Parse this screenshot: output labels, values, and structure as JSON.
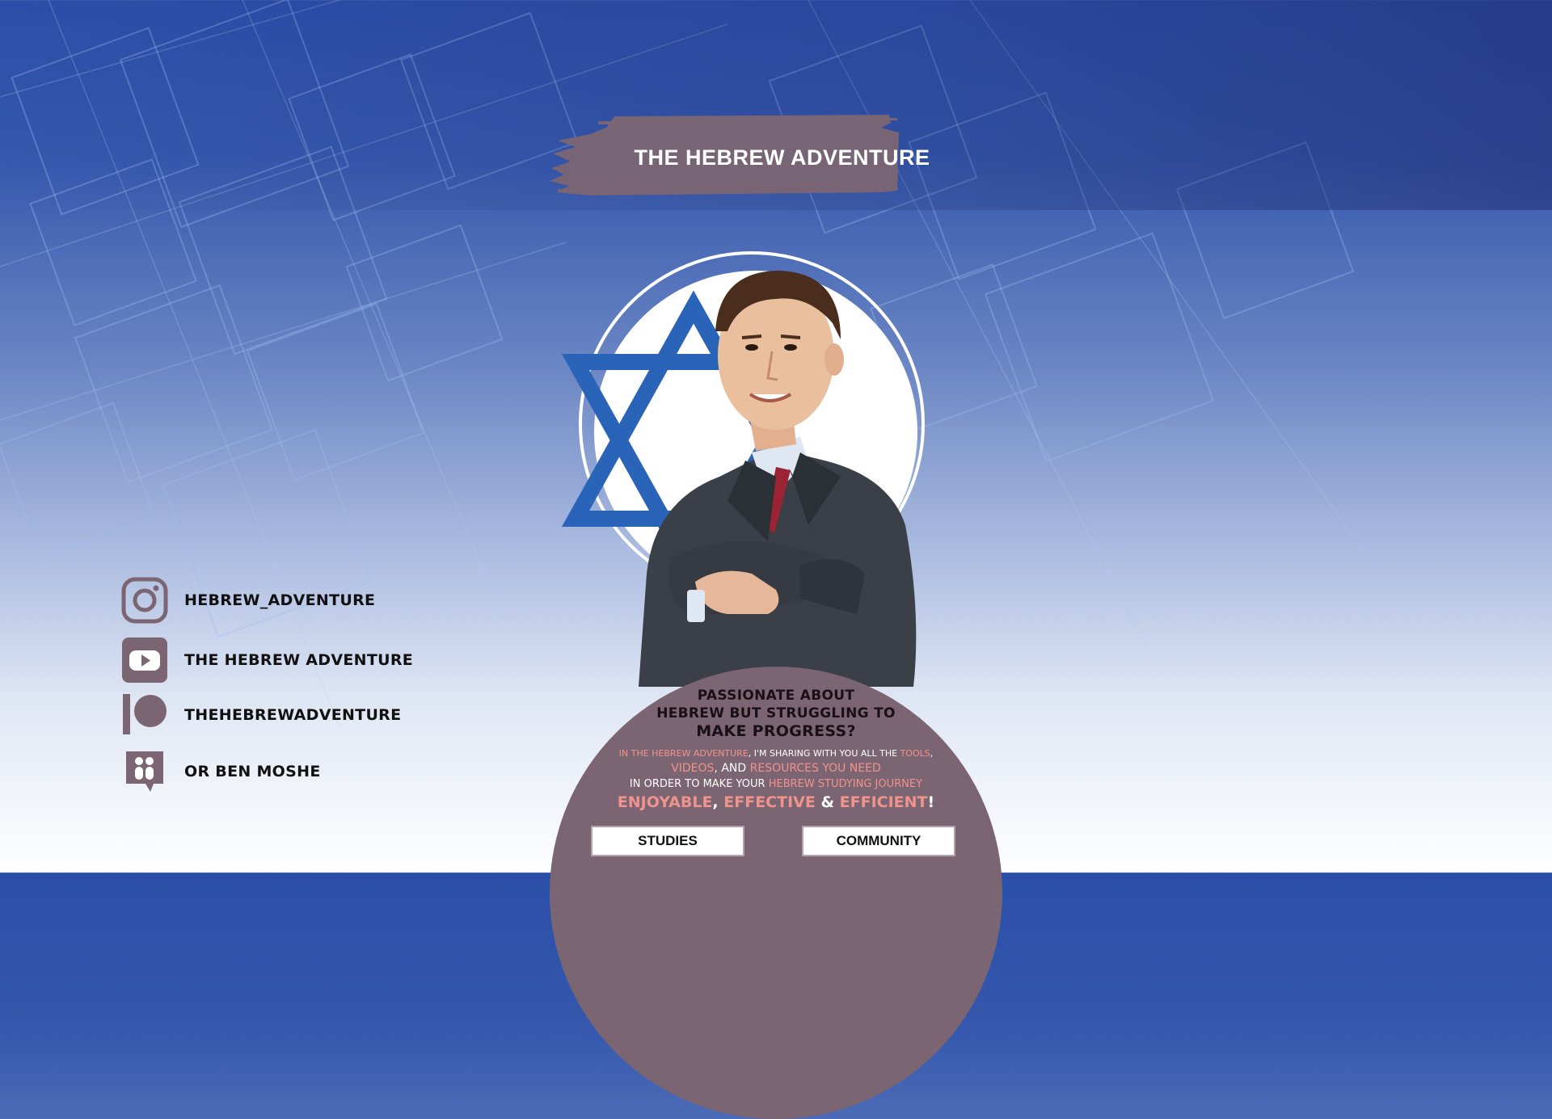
{
  "banner": {
    "title": "THE HEBREW ADVENTURE"
  },
  "social": [
    {
      "icon": "instagram-icon",
      "label": "HEBREW_ADVENTURE"
    },
    {
      "icon": "youtube-icon",
      "label": "THE HEBREW ADVENTURE"
    },
    {
      "icon": "patreon-icon",
      "label": "THEHEBREWADVENTURE"
    },
    {
      "icon": "chat-app-icon",
      "label": "OR BEN MOSHE"
    }
  ],
  "pitch": {
    "question_line1": "PASSIONATE ABOUT",
    "question_line2": "HEBREW BUT STRUGGLING TO",
    "question_line3": "MAKE PROGRESS?",
    "l1_a": "IN THE HEBREW ADVENTURE",
    "l1_b": ", I'M SHARING WITH YOU ALL THE ",
    "l1_c": "TOOLS",
    "l1_d": ",",
    "l2_a": "VIDEOS",
    "l2_b": ", AND ",
    "l2_c": "RESOURCES YOU NEED",
    "l3_a": "IN ORDER TO MAKE YOUR ",
    "l3_b": "HEBREW STUDYING JOURNEY",
    "l4_a": "ENJOYABLE",
    "l4_b": ", ",
    "l4_c": "EFFECTIVE",
    "l4_d": " & ",
    "l4_e": "EFFICIENT",
    "l4_f": "!"
  },
  "buttons": {
    "studies": "STUDIES",
    "community": "COMMUNITY"
  },
  "colors": {
    "accent": "#7b6572",
    "highlight": "#f0938c",
    "star_blue": "#2a64b8"
  }
}
